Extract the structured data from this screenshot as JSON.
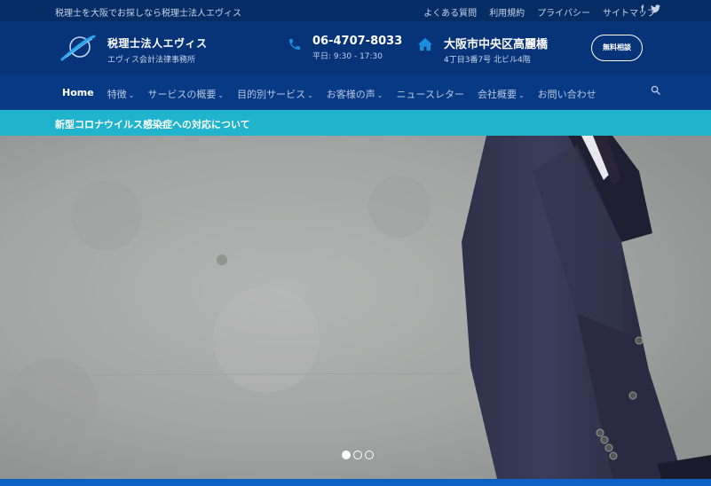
{
  "topbar": {
    "tagline": "税理士を大阪でお探しなら税理士法人エヴィス",
    "links": [
      "よくある質問",
      "利用規約",
      "プライバシー",
      "サイトマップ"
    ],
    "social": {
      "facebook": "f",
      "twitter": "t"
    }
  },
  "header": {
    "brand_name": "税理士法人エヴィス",
    "brand_sub": "エヴィス会計法律事務所",
    "phone": "06-4707-8033",
    "hours": "平日: 9:30 - 17:30",
    "address_main": "大阪市中央区高麗橋",
    "address_sub": "4丁目3番7号 北ビル4階",
    "consult_label": "無料相談"
  },
  "nav": {
    "items": [
      {
        "label": "Home",
        "dropdown": false
      },
      {
        "label": "特徴",
        "dropdown": true
      },
      {
        "label": "サービスの概要",
        "dropdown": true
      },
      {
        "label": "目的別サービス",
        "dropdown": true
      },
      {
        "label": "お客様の声",
        "dropdown": true
      },
      {
        "label": "ニュースレター",
        "dropdown": false
      },
      {
        "label": "会社概要",
        "dropdown": true
      },
      {
        "label": "お問い合わせ",
        "dropdown": false
      }
    ],
    "search_icon": "search-icon"
  },
  "notice": {
    "text": "新型コロナウイルス感染症への対応について"
  },
  "slider": {
    "slide_count": 3,
    "active_index": 0
  },
  "colors": {
    "topbar_bg": "#062c66",
    "header_bg": "#073478",
    "nav_bg": "#073a84",
    "notice_bg": "#1fb3cc",
    "accent": "#1a8fe0"
  }
}
